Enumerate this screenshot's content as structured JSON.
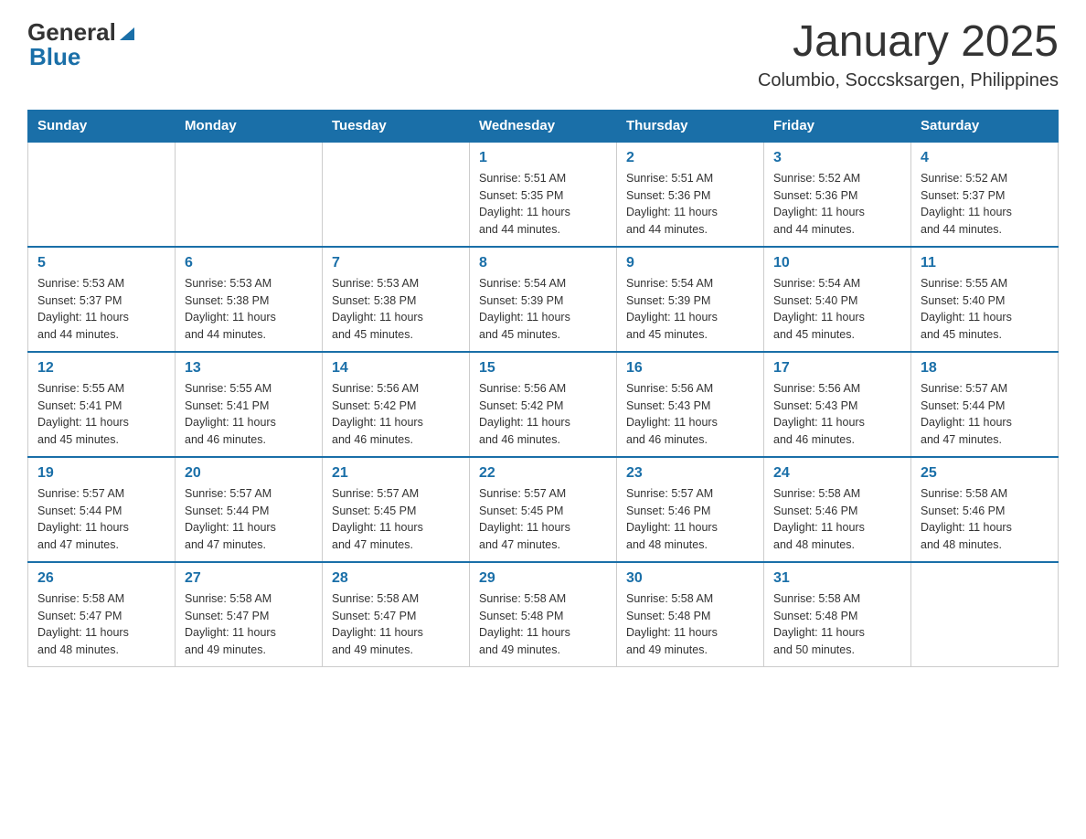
{
  "header": {
    "logo_general": "General",
    "logo_blue": "Blue",
    "month_title": "January 2025",
    "subtitle": "Columbio, Soccsksargen, Philippines"
  },
  "weekdays": [
    "Sunday",
    "Monday",
    "Tuesday",
    "Wednesday",
    "Thursday",
    "Friday",
    "Saturday"
  ],
  "weeks": [
    [
      {
        "day": "",
        "info": ""
      },
      {
        "day": "",
        "info": ""
      },
      {
        "day": "",
        "info": ""
      },
      {
        "day": "1",
        "info": "Sunrise: 5:51 AM\nSunset: 5:35 PM\nDaylight: 11 hours\nand 44 minutes."
      },
      {
        "day": "2",
        "info": "Sunrise: 5:51 AM\nSunset: 5:36 PM\nDaylight: 11 hours\nand 44 minutes."
      },
      {
        "day": "3",
        "info": "Sunrise: 5:52 AM\nSunset: 5:36 PM\nDaylight: 11 hours\nand 44 minutes."
      },
      {
        "day": "4",
        "info": "Sunrise: 5:52 AM\nSunset: 5:37 PM\nDaylight: 11 hours\nand 44 minutes."
      }
    ],
    [
      {
        "day": "5",
        "info": "Sunrise: 5:53 AM\nSunset: 5:37 PM\nDaylight: 11 hours\nand 44 minutes."
      },
      {
        "day": "6",
        "info": "Sunrise: 5:53 AM\nSunset: 5:38 PM\nDaylight: 11 hours\nand 44 minutes."
      },
      {
        "day": "7",
        "info": "Sunrise: 5:53 AM\nSunset: 5:38 PM\nDaylight: 11 hours\nand 45 minutes."
      },
      {
        "day": "8",
        "info": "Sunrise: 5:54 AM\nSunset: 5:39 PM\nDaylight: 11 hours\nand 45 minutes."
      },
      {
        "day": "9",
        "info": "Sunrise: 5:54 AM\nSunset: 5:39 PM\nDaylight: 11 hours\nand 45 minutes."
      },
      {
        "day": "10",
        "info": "Sunrise: 5:54 AM\nSunset: 5:40 PM\nDaylight: 11 hours\nand 45 minutes."
      },
      {
        "day": "11",
        "info": "Sunrise: 5:55 AM\nSunset: 5:40 PM\nDaylight: 11 hours\nand 45 minutes."
      }
    ],
    [
      {
        "day": "12",
        "info": "Sunrise: 5:55 AM\nSunset: 5:41 PM\nDaylight: 11 hours\nand 45 minutes."
      },
      {
        "day": "13",
        "info": "Sunrise: 5:55 AM\nSunset: 5:41 PM\nDaylight: 11 hours\nand 46 minutes."
      },
      {
        "day": "14",
        "info": "Sunrise: 5:56 AM\nSunset: 5:42 PM\nDaylight: 11 hours\nand 46 minutes."
      },
      {
        "day": "15",
        "info": "Sunrise: 5:56 AM\nSunset: 5:42 PM\nDaylight: 11 hours\nand 46 minutes."
      },
      {
        "day": "16",
        "info": "Sunrise: 5:56 AM\nSunset: 5:43 PM\nDaylight: 11 hours\nand 46 minutes."
      },
      {
        "day": "17",
        "info": "Sunrise: 5:56 AM\nSunset: 5:43 PM\nDaylight: 11 hours\nand 46 minutes."
      },
      {
        "day": "18",
        "info": "Sunrise: 5:57 AM\nSunset: 5:44 PM\nDaylight: 11 hours\nand 47 minutes."
      }
    ],
    [
      {
        "day": "19",
        "info": "Sunrise: 5:57 AM\nSunset: 5:44 PM\nDaylight: 11 hours\nand 47 minutes."
      },
      {
        "day": "20",
        "info": "Sunrise: 5:57 AM\nSunset: 5:44 PM\nDaylight: 11 hours\nand 47 minutes."
      },
      {
        "day": "21",
        "info": "Sunrise: 5:57 AM\nSunset: 5:45 PM\nDaylight: 11 hours\nand 47 minutes."
      },
      {
        "day": "22",
        "info": "Sunrise: 5:57 AM\nSunset: 5:45 PM\nDaylight: 11 hours\nand 47 minutes."
      },
      {
        "day": "23",
        "info": "Sunrise: 5:57 AM\nSunset: 5:46 PM\nDaylight: 11 hours\nand 48 minutes."
      },
      {
        "day": "24",
        "info": "Sunrise: 5:58 AM\nSunset: 5:46 PM\nDaylight: 11 hours\nand 48 minutes."
      },
      {
        "day": "25",
        "info": "Sunrise: 5:58 AM\nSunset: 5:46 PM\nDaylight: 11 hours\nand 48 minutes."
      }
    ],
    [
      {
        "day": "26",
        "info": "Sunrise: 5:58 AM\nSunset: 5:47 PM\nDaylight: 11 hours\nand 48 minutes."
      },
      {
        "day": "27",
        "info": "Sunrise: 5:58 AM\nSunset: 5:47 PM\nDaylight: 11 hours\nand 49 minutes."
      },
      {
        "day": "28",
        "info": "Sunrise: 5:58 AM\nSunset: 5:47 PM\nDaylight: 11 hours\nand 49 minutes."
      },
      {
        "day": "29",
        "info": "Sunrise: 5:58 AM\nSunset: 5:48 PM\nDaylight: 11 hours\nand 49 minutes."
      },
      {
        "day": "30",
        "info": "Sunrise: 5:58 AM\nSunset: 5:48 PM\nDaylight: 11 hours\nand 49 minutes."
      },
      {
        "day": "31",
        "info": "Sunrise: 5:58 AM\nSunset: 5:48 PM\nDaylight: 11 hours\nand 50 minutes."
      },
      {
        "day": "",
        "info": ""
      }
    ]
  ]
}
